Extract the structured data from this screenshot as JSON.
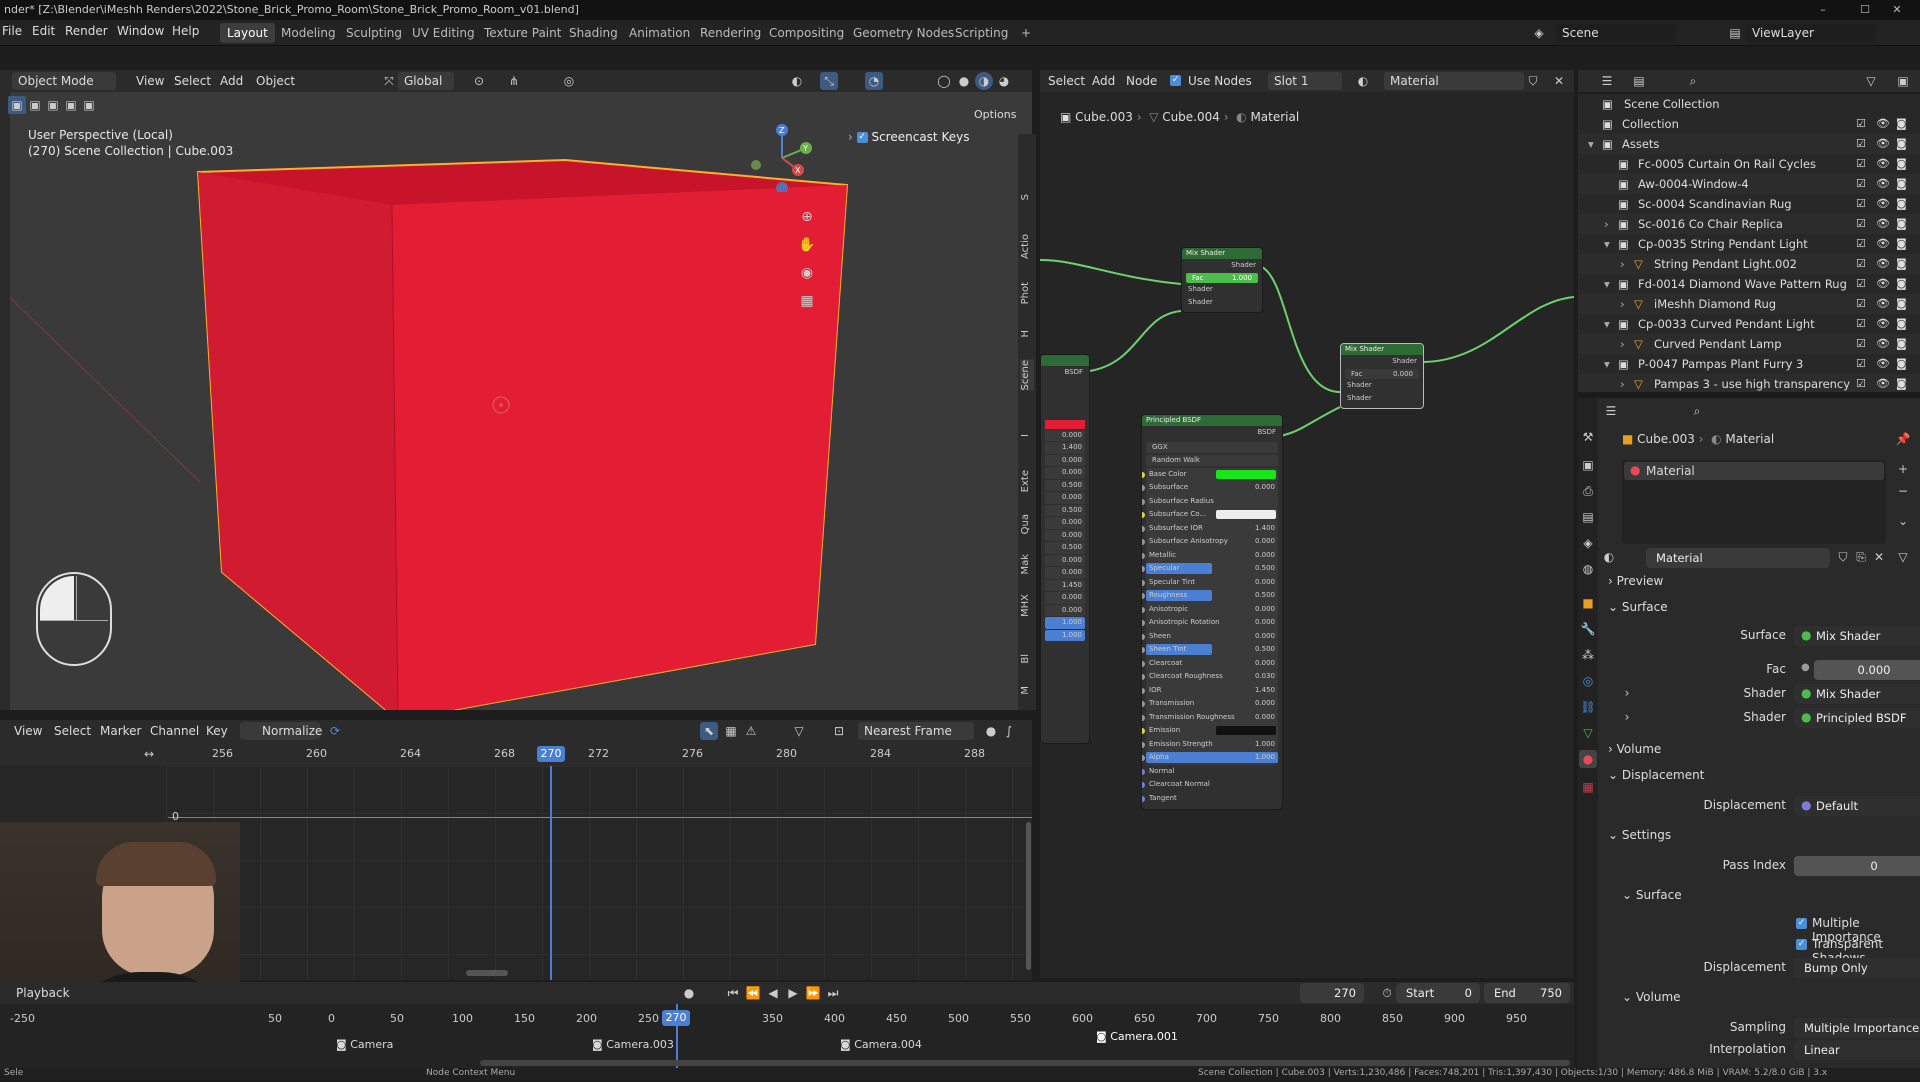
{
  "title": "nder* [Z:\\Blender\\iMeshh Renders\\2022\\Stone_Brick_Promo_Room\\Stone_Brick_Promo_Room_v01.blend]",
  "window_buttons": [
    "–",
    "☐",
    "✕"
  ],
  "menus": [
    "File",
    "Edit",
    "Render",
    "Window",
    "Help"
  ],
  "workspaces": [
    "Layout",
    "Modeling",
    "Sculpting",
    "UV Editing",
    "Texture Paint",
    "Shading",
    "Animation",
    "Rendering",
    "Compositing",
    "Geometry Nodes",
    "Scripting"
  ],
  "add_workspace": "+",
  "scene": {
    "label": "Scene",
    "view_layer": "ViewLayer"
  },
  "viewport": {
    "mode": "Object Mode",
    "menus": [
      "View",
      "Select",
      "Add",
      "Object"
    ],
    "orientation": "Global",
    "options": "Options",
    "perspective": "User Perspective (Local)",
    "collection": "(270) Scene Collection | Cube.003",
    "screencast": "Screencast Keys",
    "accent": "#e8122e",
    "gizmo": {
      "z": "Z",
      "y": "Y",
      "x": "X"
    }
  },
  "side_tabs": [
    "S",
    "Actio",
    "Phot",
    "H",
    "Scene",
    "I",
    "Exte",
    "Qua",
    "Mak",
    "MHX",
    "Bl",
    "M"
  ],
  "node_editor": {
    "menus": [
      "Select",
      "Add",
      "Node"
    ],
    "use_nodes": "Use Nodes",
    "slot": "Slot 1",
    "material": "Material",
    "breadcrumb": [
      "Cube.003",
      "Cube.004",
      "Material"
    ],
    "mix1": {
      "title": "Mix Shader",
      "out": "Shader",
      "fac": "Fac",
      "fac_val": "1.000",
      "in1": "Shader",
      "in2": "Shader"
    },
    "mix2": {
      "title": "Mix Shader",
      "out": "Shader",
      "fac": "Fac",
      "fac_val": "0.000",
      "in1": "Shader",
      "in2": "Shader"
    },
    "left_node": {
      "out": "BSDF",
      "values": [
        "0.000",
        "1.400",
        "0.000",
        "0.000",
        "0.500",
        "0.000",
        "0.500",
        "0.000",
        "0.000",
        "0.500",
        "0.000",
        "0.000",
        "1.450",
        "0.000",
        "0.000",
        "1.000",
        "1.000"
      ]
    },
    "principled": {
      "title": "Principled BSDF",
      "out": "BSDF",
      "dist": "GGX",
      "sss": "Random Walk",
      "rows": [
        [
          "Base Color",
          ""
        ],
        [
          "Subsurface",
          "0.000"
        ],
        [
          "Subsurface Radius",
          ""
        ],
        [
          "Subsurface Co...",
          ""
        ],
        [
          "Subsurface IOR",
          "1.400"
        ],
        [
          "Subsurface Anisotropy",
          "0.000"
        ],
        [
          "Metallic",
          "0.000"
        ],
        [
          "Specular",
          "0.500"
        ],
        [
          "Specular Tint",
          "0.000"
        ],
        [
          "Roughness",
          "0.500"
        ],
        [
          "Anisotropic",
          "0.000"
        ],
        [
          "Anisotropic Rotation",
          "0.000"
        ],
        [
          "Sheen",
          "0.000"
        ],
        [
          "Sheen Tint",
          "0.500"
        ],
        [
          "Clearcoat",
          "0.000"
        ],
        [
          "Clearcoat Roughness",
          "0.030"
        ],
        [
          "IOR",
          "1.450"
        ],
        [
          "Transmission",
          "0.000"
        ],
        [
          "Transmission Roughness",
          "0.000"
        ],
        [
          "Emission",
          ""
        ],
        [
          "Emission Strength",
          "1.000"
        ],
        [
          "Alpha",
          "1.000"
        ],
        [
          "Normal",
          ""
        ],
        [
          "Clearcoat Normal",
          ""
        ],
        [
          "Tangent",
          ""
        ]
      ],
      "base_color": "#19e619"
    }
  },
  "outliner": {
    "root": "Scene Collection",
    "items": [
      {
        "label": "Collection",
        "depth": 1,
        "expand": ""
      },
      {
        "label": "Assets",
        "depth": 1,
        "expand": "▾"
      },
      {
        "label": "Fc-0005 Curtain On Rail Cycles",
        "depth": 2,
        "expand": ""
      },
      {
        "label": "Aw-0004-Window-4",
        "depth": 2,
        "expand": ""
      },
      {
        "label": "Sc-0004 Scandinavian Rug",
        "depth": 2,
        "expand": ""
      },
      {
        "label": "Sc-0016 Co Chair Replica",
        "depth": 2,
        "expand": "›"
      },
      {
        "label": "Cp-0035 String Pendant Light",
        "depth": 2,
        "expand": "▾"
      },
      {
        "label": "String Pendant Light.002",
        "depth": 3,
        "expand": "›"
      },
      {
        "label": "Fd-0014 Diamond Wave Pattern Rug",
        "depth": 2,
        "expand": "▾"
      },
      {
        "label": "iMeshh Diamond Rug",
        "depth": 3,
        "expand": "›"
      },
      {
        "label": "Cp-0033 Curved Pendant Light",
        "depth": 2,
        "expand": "▾"
      },
      {
        "label": "Curved Pendant Lamp",
        "depth": 3,
        "expand": "›"
      },
      {
        "label": "P-0047 Pampas Plant Furry 3",
        "depth": 2,
        "expand": "▾"
      },
      {
        "label": "Pampas 3 - use high transparency",
        "depth": 3,
        "expand": "›"
      }
    ]
  },
  "properties": {
    "object": "Cube.003",
    "material_tab": "Material",
    "slot_material": "Material",
    "material_name": "Material",
    "preview": "Preview",
    "surface_panel": "Surface",
    "surface_label": "Surface",
    "surface_value": "Mix Shader",
    "fac_label": "Fac",
    "fac_value": "0.000",
    "shader1_label": "Shader",
    "shader1_value": "Mix Shader",
    "shader2_label": "Shader",
    "shader2_value": "Principled BSDF",
    "volume": "Volume",
    "displacement_panel": "Displacement",
    "displacement_label": "Displacement",
    "displacement_value": "Default",
    "settings": "Settings",
    "pass_index_label": "Pass Index",
    "pass_index_value": "0",
    "sub_surface": "Surface",
    "multiple_importance": "Multiple Importance",
    "transparent_shadows": "Transparent Shadows",
    "disp_method_label": "Displacement",
    "disp_method": "Bump Only",
    "sub_volume": "Volume",
    "sampling_label": "Sampling",
    "sampling": "Multiple Importance",
    "interp_label": "Interpolation",
    "interp": "Linear"
  },
  "graph": {
    "menus": [
      "View",
      "Select",
      "Marker",
      "Channel",
      "Key"
    ],
    "normalize": "Normalize",
    "snap": "Nearest Frame",
    "ticks": [
      "256",
      "260",
      "264",
      "268",
      "270",
      "272",
      "276",
      "280",
      "284",
      "288"
    ],
    "current": "270",
    "zero": "0"
  },
  "timeline": {
    "playback": "Playback",
    "frame": "270",
    "start_label": "Start",
    "start": "0",
    "end_label": "End",
    "end": "750",
    "ticks": [
      "-250",
      "50",
      "0",
      "50",
      "100",
      "150",
      "200",
      "250",
      "300",
      "350",
      "400",
      "450",
      "500",
      "550",
      "600",
      "650",
      "700",
      "750",
      "800",
      "850",
      "900",
      "950"
    ],
    "current": "270",
    "markers": [
      "Camera",
      "Camera.003",
      "Camera.004",
      "Camera.001"
    ]
  },
  "status": {
    "left": "Sele",
    "mid": "Node Context Menu",
    "right": "Scene Collection | Cube.003 | Verts:1,230,486 | Faces:748,201 | Tris:1,397,430 | Objects:1/30 | Memory: 486.8 MiB | VRAM: 5.2/8.0 GiB | 3.x"
  }
}
